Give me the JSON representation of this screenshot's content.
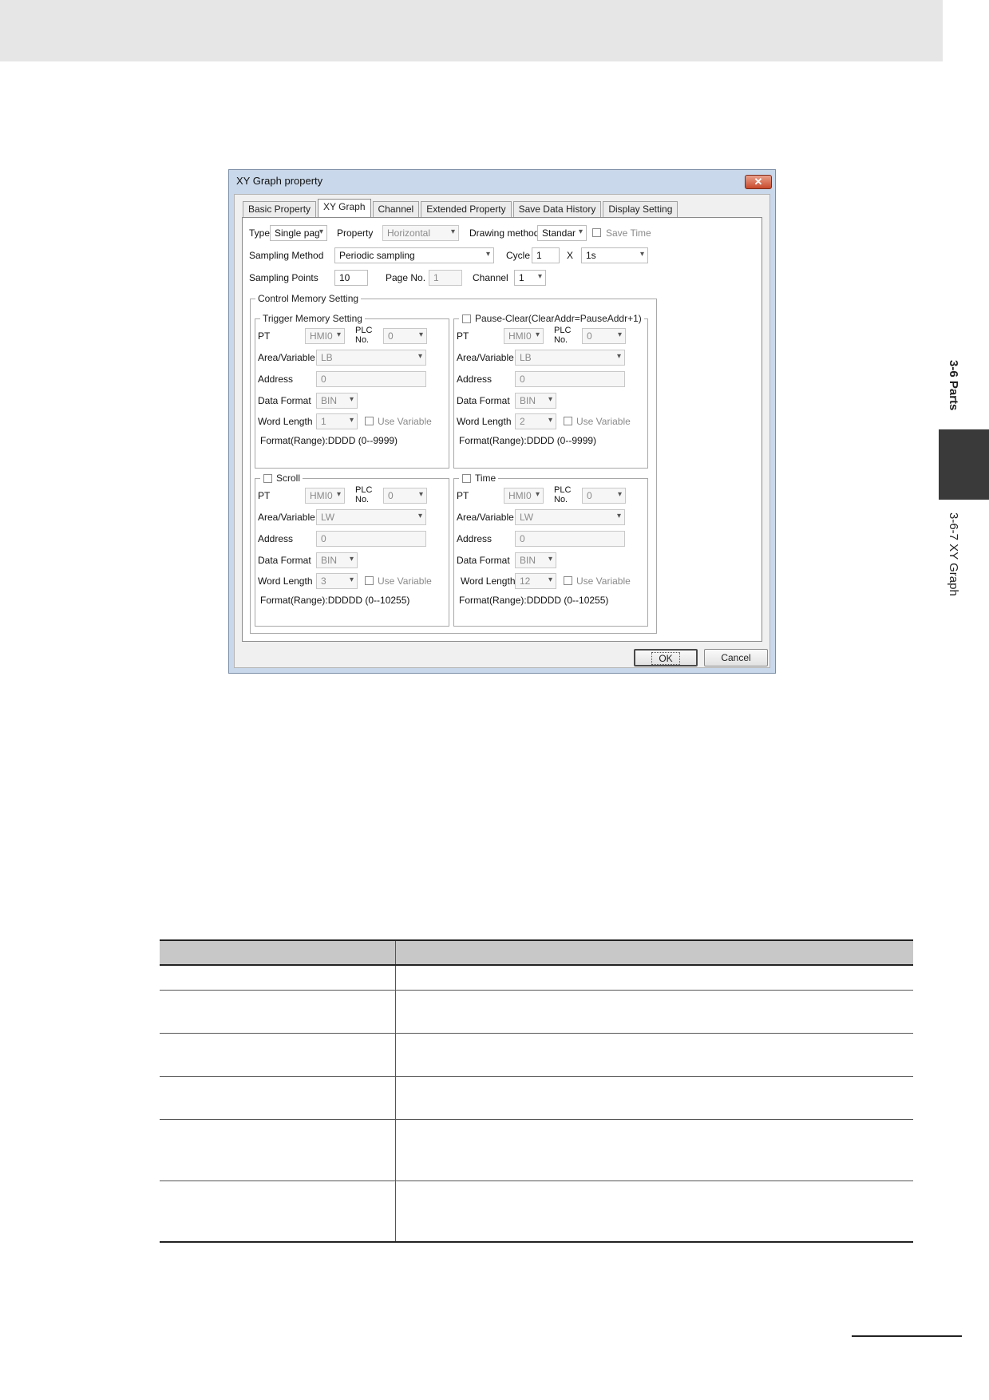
{
  "side_tab": {
    "section": "3-6 Parts",
    "subsection": "3-6-7 XY Graph"
  },
  "dialog": {
    "title": "XY Graph property",
    "close_glyph": "✕",
    "tabs": [
      "Basic Property",
      "XY Graph",
      "Channel",
      "Extended Property",
      "Save Data History",
      "Display Setting"
    ],
    "active_tab": "XY Graph",
    "type_label": "Type",
    "type_value": "Single pag",
    "property_label": "Property",
    "property_value": "Horizontal",
    "drawing_method_label": "Drawing method",
    "drawing_method_value": "Standar",
    "save_time_label": "Save Time",
    "sampling_method_label": "Sampling Method",
    "sampling_method_value": "Periodic sampling",
    "cycle_label": "Cycle",
    "cycle_value": "1",
    "x_label": "X",
    "cycle_unit": "1s",
    "sampling_points_label": "Sampling Points",
    "sampling_points_value": "10",
    "page_no_label": "Page No.",
    "page_no_value": "1",
    "channel_label": "Channel",
    "channel_value": "1",
    "control_memory_title": "Control Memory Setting",
    "groups": {
      "trigger": {
        "title": "Trigger Memory Setting",
        "pt": "HMI0",
        "plc_no": "0",
        "area": "LB",
        "address": "0",
        "data_format": "BIN",
        "word_length": "1",
        "format_range": "Format(Range):DDDD (0--9999)"
      },
      "pause": {
        "title": "Pause-Clear(ClearAddr=PauseAddr+1)",
        "pt": "HMI0",
        "plc_no": "0",
        "area": "LB",
        "address": "0",
        "data_format": "BIN",
        "word_length": "2",
        "format_range": "Format(Range):DDDD (0--9999)"
      },
      "scroll": {
        "title": "Scroll",
        "pt": "HMI0",
        "plc_no": "0",
        "area": "LW",
        "address": "0",
        "data_format": "BIN",
        "word_length": "3",
        "format_range": "Format(Range):DDDDD (0--10255)"
      },
      "time": {
        "title": "Time",
        "pt": "HMI0",
        "plc_no": "0",
        "area": "LW",
        "address": "0",
        "data_format": "BIN",
        "word_length": "12",
        "format_range": "Format(Range):DDDDD (0--10255)"
      }
    },
    "labels": {
      "pt": "PT",
      "plc_line1": "PLC",
      "plc_line2": "No.",
      "area": "Area/Variable",
      "address": "Address",
      "data_format": "Data Format",
      "word_length": "Word Length",
      "use_variable": "Use Variable"
    },
    "ok_label": "OK",
    "cancel_label": "Cancel"
  }
}
